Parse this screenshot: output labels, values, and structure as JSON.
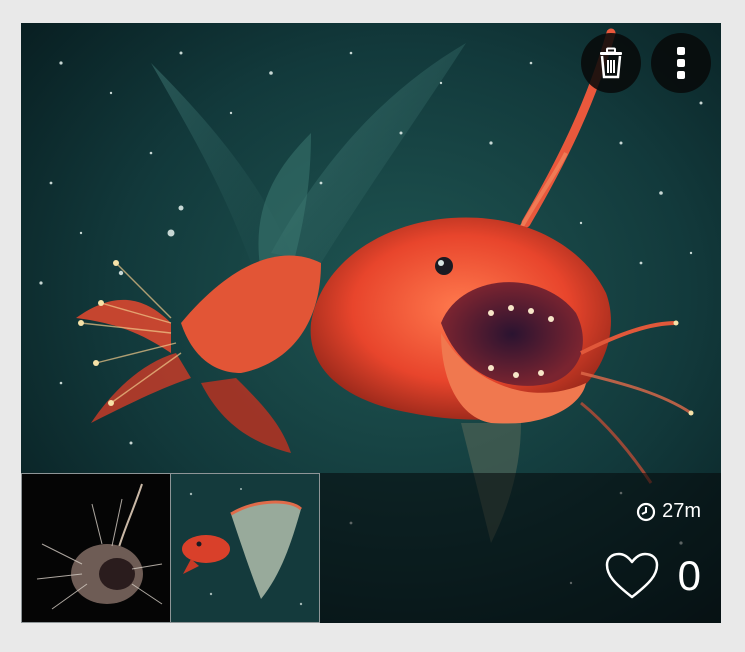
{
  "post": {
    "time_ago": "27m",
    "like_count": "0"
  },
  "icons": {
    "delete": "trash-icon",
    "more": "more-vertical-icon",
    "time": "clock-icon",
    "like": "heart-outline-icon"
  },
  "colors": {
    "page_background": "#e9e9e9",
    "button_background": "#0a0c0c",
    "icon_foreground": "#ffffff",
    "fish_red": "#e8452c",
    "water": "#0f3436"
  }
}
